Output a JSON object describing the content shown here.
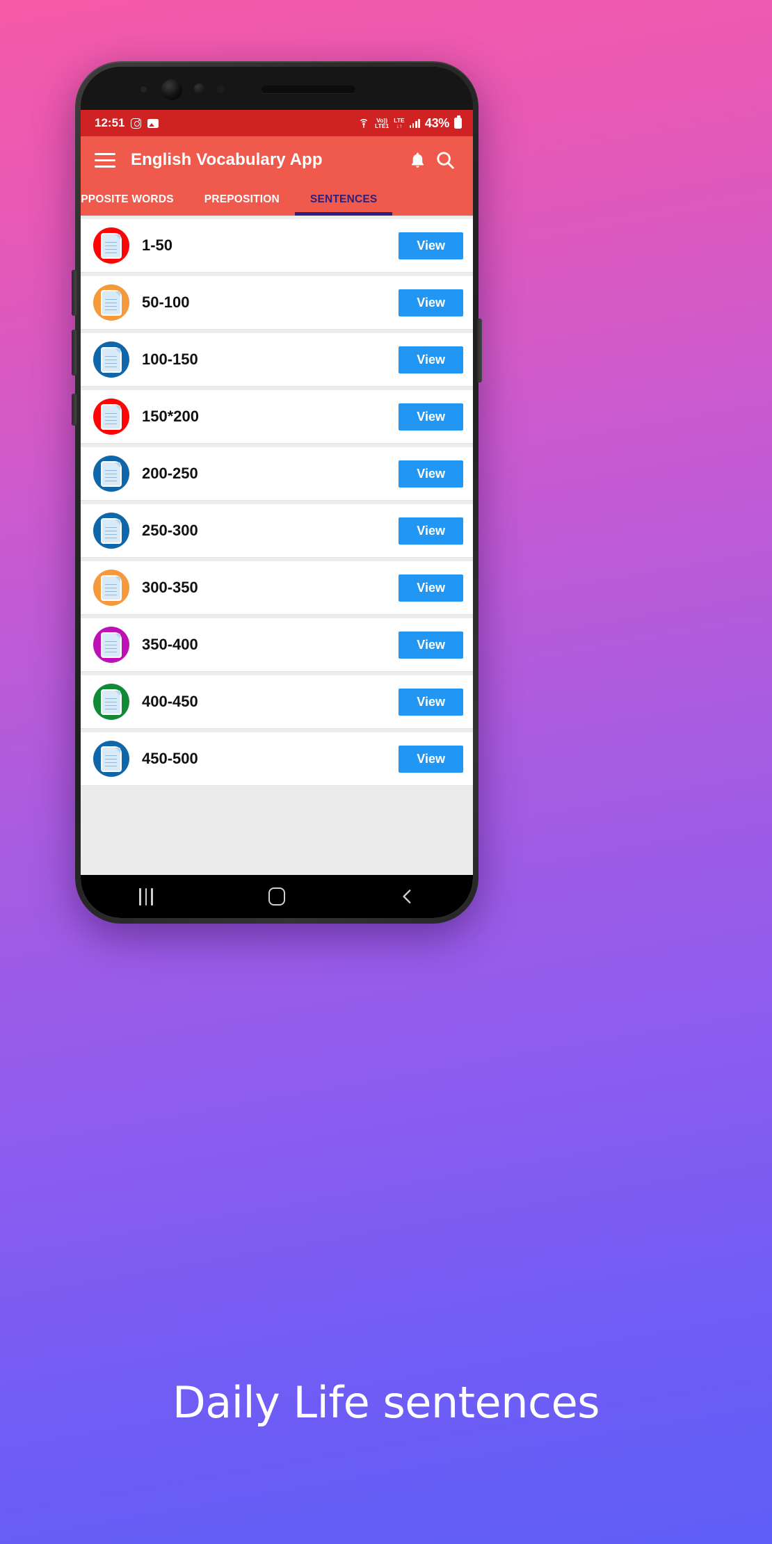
{
  "status_bar": {
    "time": "12:51",
    "icons_left": [
      "instagram-icon",
      "gallery-icon"
    ],
    "volte_line1": "Vo))",
    "volte_line2": "LTE1",
    "lte_label": "LTE",
    "lte_arrows": "↓↑",
    "battery_percent": "43%",
    "background_color": "#cf2323"
  },
  "app_bar": {
    "menu_icon": "hamburger-menu-icon",
    "title": "English Vocabulary App",
    "notification_icon": "bell-icon",
    "search_icon": "search-icon",
    "background_color": "#ef5a4c"
  },
  "tabs": {
    "items": [
      {
        "label": "OPPOSITE WORDS",
        "active": false
      },
      {
        "label": "PREPOSITION",
        "active": false
      },
      {
        "label": "SENTENCES",
        "active": true
      }
    ],
    "active_color": "#2b2180"
  },
  "list": {
    "view_button_label": "View",
    "view_button_color": "#2196f3",
    "rows": [
      {
        "label": "1-50",
        "icon": "document-icon",
        "icon_color": "#fb0606"
      },
      {
        "label": "50-100",
        "icon": "document-icon",
        "icon_color": "#f5993d"
      },
      {
        "label": "100-150",
        "icon": "document-icon",
        "icon_color": "#0f66a8"
      },
      {
        "label": "150*200",
        "icon": "document-icon",
        "icon_color": "#fb0606"
      },
      {
        "label": "200-250",
        "icon": "document-icon",
        "icon_color": "#0f66a8"
      },
      {
        "label": "250-300",
        "icon": "document-icon",
        "icon_color": "#0f66a8"
      },
      {
        "label": "300-350",
        "icon": "document-icon",
        "icon_color": "#f5993d"
      },
      {
        "label": "350-400",
        "icon": "document-icon",
        "icon_color": "#bd11b5"
      },
      {
        "label": "400-450",
        "icon": "document-icon",
        "icon_color": "#128934"
      },
      {
        "label": "450-500",
        "icon": "document-icon",
        "icon_color": "#0f66a8"
      }
    ]
  },
  "nav_bar": {
    "recents_icon": "recents-icon",
    "home_icon": "home-icon",
    "back_icon": "back-chevron-icon"
  },
  "caption": {
    "text": "Daily Life sentences"
  }
}
